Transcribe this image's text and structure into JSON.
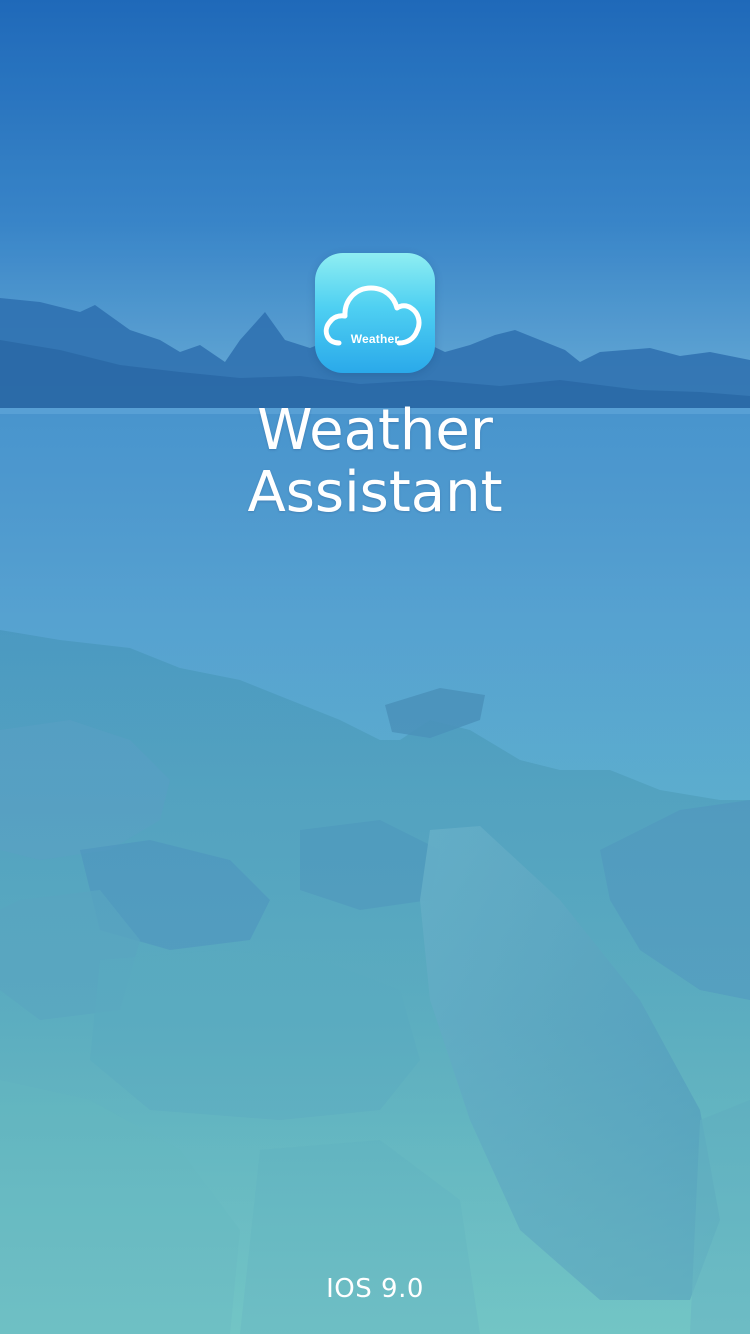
{
  "splash": {
    "icon": {
      "name": "weather-cloud-icon",
      "label": "Weather",
      "gradient_top": "#8feef2",
      "gradient_bottom": "#2aa9ea"
    },
    "title_line1": "Weather",
    "title_line2": "Assistant",
    "version": "IOS 9.0"
  },
  "colors": {
    "sky_top": "#1f68b9",
    "lake": "#4c9ad0",
    "rocks": "#63b6c2",
    "text": "#ffffff"
  }
}
